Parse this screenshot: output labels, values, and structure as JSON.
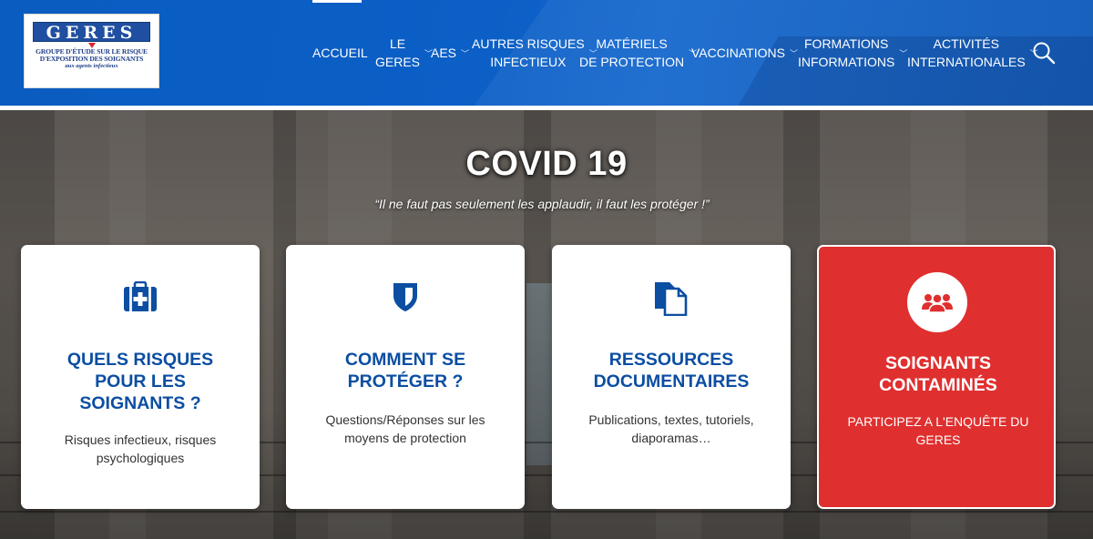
{
  "header": {
    "logo": {
      "word": "GERES",
      "line1": "GROUPE D'ÉTUDE SUR LE RISQUE",
      "line2": "D'EXPOSITION DES SOIGNANTS",
      "line3": "aux agents infectieux"
    },
    "nav": [
      {
        "line1": "ACCUEIL",
        "line2": "",
        "has_dropdown": false,
        "active": true
      },
      {
        "line1": "LE",
        "line2": "GERES",
        "has_dropdown": true
      },
      {
        "line1": "AES",
        "line2": "",
        "has_dropdown": true
      },
      {
        "line1": "AUTRES RISQUES",
        "line2": "INFECTIEUX",
        "has_dropdown": true
      },
      {
        "line1": "MATÉRIELS",
        "line2": "DE PROTECTION",
        "has_dropdown": true
      },
      {
        "line1": "VACCINATIONS",
        "line2": "",
        "has_dropdown": true
      },
      {
        "line1": "FORMATIONS",
        "line2": "INFORMATIONS",
        "has_dropdown": true
      },
      {
        "line1": "ACTIVITÉS",
        "line2": "INTERNATIONALES",
        "has_dropdown": true
      }
    ],
    "search_icon": "search-icon"
  },
  "hero": {
    "title": "COVID 19",
    "quote": "“Il ne faut pas seulement les applaudir, il faut les protéger !”"
  },
  "cards": [
    {
      "icon": "medical-kit-icon",
      "title_lines": [
        "QUELS RISQUES",
        "POUR LES",
        "SOIGNANTS ?"
      ],
      "desc_lines": [
        "Risques infectieux, risques",
        "psychologiques"
      ]
    },
    {
      "icon": "shield-icon",
      "title_lines": [
        "COMMENT SE",
        "PROTÉGER ?"
      ],
      "desc_lines": [
        "Questions/Réponses sur les",
        "moyens de protection"
      ]
    },
    {
      "icon": "documents-icon",
      "title_lines": [
        "RESSOURCES",
        "DOCUMENTAIRES"
      ],
      "desc_lines": [
        "Publications, textes, tutoriels,",
        "diaporamas…"
      ]
    },
    {
      "icon": "users-group-icon",
      "title_lines": [
        "SOIGNANTS",
        "CONTAMINÉS"
      ],
      "desc_lines": [
        "PARTICIPEZ A L'ENQUÊTE DU",
        "GERES"
      ]
    }
  ],
  "colors": {
    "header_blue": "#0b5fc6",
    "title_blue": "#0b4ea2",
    "alert_red": "#e02f2f"
  }
}
